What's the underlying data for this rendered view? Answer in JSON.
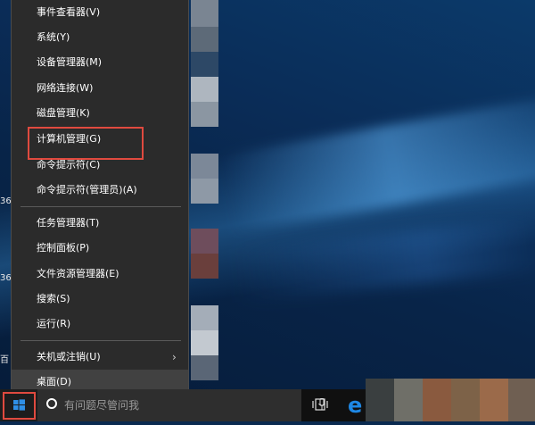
{
  "context_menu": {
    "items": [
      {
        "label": "事件查看器(V)"
      },
      {
        "label": "系统(Y)"
      },
      {
        "label": "设备管理器(M)"
      },
      {
        "label": "网络连接(W)"
      },
      {
        "label": "磁盘管理(K)"
      },
      {
        "label": "计算机管理(G)"
      },
      {
        "label": "命令提示符(C)"
      },
      {
        "label": "命令提示符(管理员)(A)"
      },
      {
        "label": "任务管理器(T)"
      },
      {
        "label": "控制面板(P)"
      },
      {
        "label": "文件资源管理器(E)"
      },
      {
        "label": "搜索(S)"
      },
      {
        "label": "运行(R)"
      },
      {
        "label": "关机或注销(U)"
      },
      {
        "label": "桌面(D)"
      }
    ],
    "highlighted_item": "计算机管理(G)",
    "hovered_item": "桌面(D)"
  },
  "taskbar": {
    "search_placeholder": "有问题尽管问我"
  },
  "desktop": {
    "stub_labels": [
      "36",
      "36",
      "百"
    ]
  },
  "colors": {
    "menu_bg": "#2b2b2b",
    "highlight_outline": "#e04a3f",
    "taskbar_bg": "#101010",
    "edge_blue": "#1e88e5"
  },
  "icons": [
    "windows-logo-icon",
    "cortana-circle-icon",
    "microphone-icon",
    "task-view-icon",
    "edge-icon",
    "chevron-right-icon"
  ]
}
